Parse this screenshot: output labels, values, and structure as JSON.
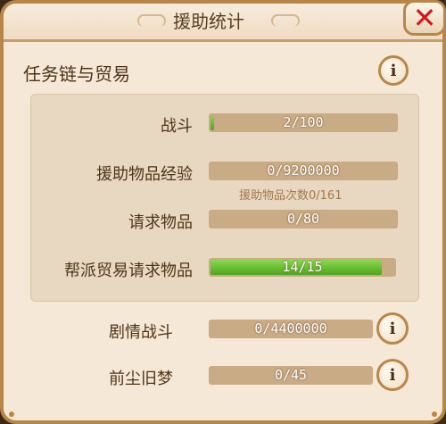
{
  "window": {
    "title": "援助统计"
  },
  "section": {
    "title": "任务链与贸易"
  },
  "rows": [
    {
      "label": "战斗",
      "value": "2/100",
      "progress": 0.02
    },
    {
      "label": "援助物品经验",
      "value": "0/9200000",
      "progress": 0
    },
    {
      "label": "请求物品",
      "value": "0/80",
      "progress": 0
    },
    {
      "label": "帮派贸易请求物品",
      "value": "14/15",
      "progress": 0.933
    }
  ],
  "subnote": "援助物品次数0/161",
  "bottom_rows": [
    {
      "label": "剧情战斗",
      "value": "0/4400000",
      "progress": 0
    },
    {
      "label": "前尘旧梦",
      "value": "0/45",
      "progress": 0
    }
  ],
  "icons": {
    "close": "close-icon",
    "info": "info-icon"
  },
  "colors": {
    "panel": "#f5e8d6",
    "border": "#b9864a",
    "bar": "#c9ab85",
    "fill": "#5fb52a",
    "close": "#d01717"
  }
}
